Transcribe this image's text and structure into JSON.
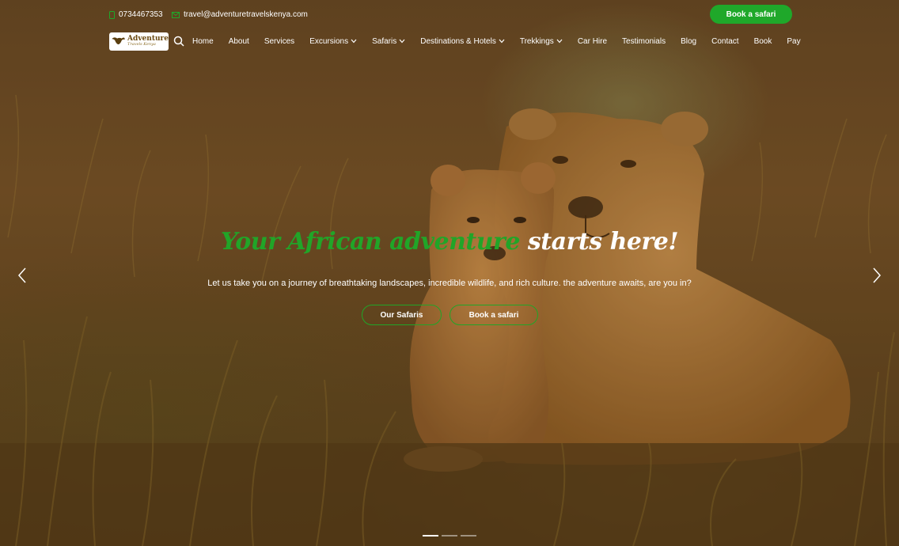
{
  "topbar": {
    "phone": "0734467353",
    "email": "travel@adventuretravelskenya.com",
    "book_button": "Book a safari"
  },
  "logo": {
    "line1": "Adventure",
    "line2": "Travels Kenya"
  },
  "nav": {
    "items": [
      {
        "label": "Home",
        "dropdown": false
      },
      {
        "label": "About",
        "dropdown": false
      },
      {
        "label": "Services",
        "dropdown": false
      },
      {
        "label": "Excursions",
        "dropdown": true
      },
      {
        "label": "Safaris",
        "dropdown": true
      },
      {
        "label": "Destinations & Hotels",
        "dropdown": true
      },
      {
        "label": "Trekkings",
        "dropdown": true
      },
      {
        "label": "Car Hire",
        "dropdown": false
      },
      {
        "label": "Testimonials",
        "dropdown": false
      },
      {
        "label": "Blog",
        "dropdown": false
      },
      {
        "label": "Contact",
        "dropdown": false
      },
      {
        "label": "Book",
        "dropdown": false
      },
      {
        "label": "Pay",
        "dropdown": false
      }
    ]
  },
  "hero": {
    "headline_green": "Your African adventure",
    "headline_white": "starts here!",
    "subtitle": "Let us take you on a journey of breathtaking landscapes, incredible wildlife, and rich culture. the adventure awaits, are you in?",
    "cta_primary": "Our Safaris",
    "cta_secondary": "Book a safari"
  },
  "slider": {
    "slide_count": 3,
    "active_index": 0
  },
  "colors": {
    "accent": "#1fa82a",
    "text": "#ffffff"
  }
}
